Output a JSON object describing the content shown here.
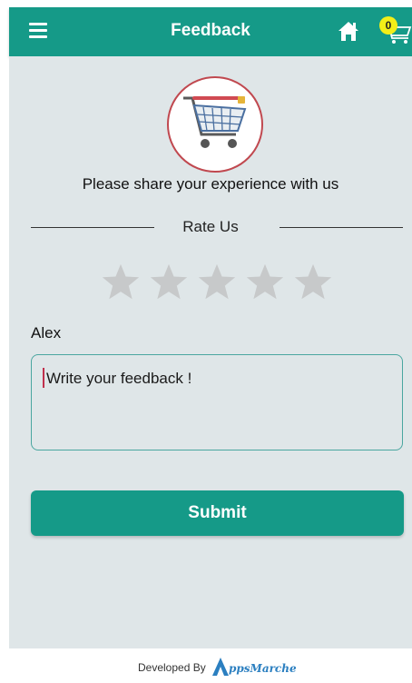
{
  "appbar": {
    "title": "Feedback",
    "cart_count": "0"
  },
  "main": {
    "subtitle": "Please share your experience with us",
    "rate_label": "Rate Us",
    "rating": 0,
    "rating_max": 5,
    "user_name": "Alex",
    "feedback_placeholder": "Write your feedback !",
    "submit_label": "Submit"
  },
  "footer": {
    "developed_by": "Developed By",
    "brand": "ppsMarche"
  },
  "colors": {
    "primary": "#159a88",
    "background": "#dfe6e8",
    "star_empty": "#c7c9ca",
    "badge": "#f3ee18"
  },
  "icons": [
    "menu-icon",
    "home-icon",
    "cart-icon",
    "star-icon",
    "shopping-cart-logo",
    "appsmarche-logo"
  ]
}
